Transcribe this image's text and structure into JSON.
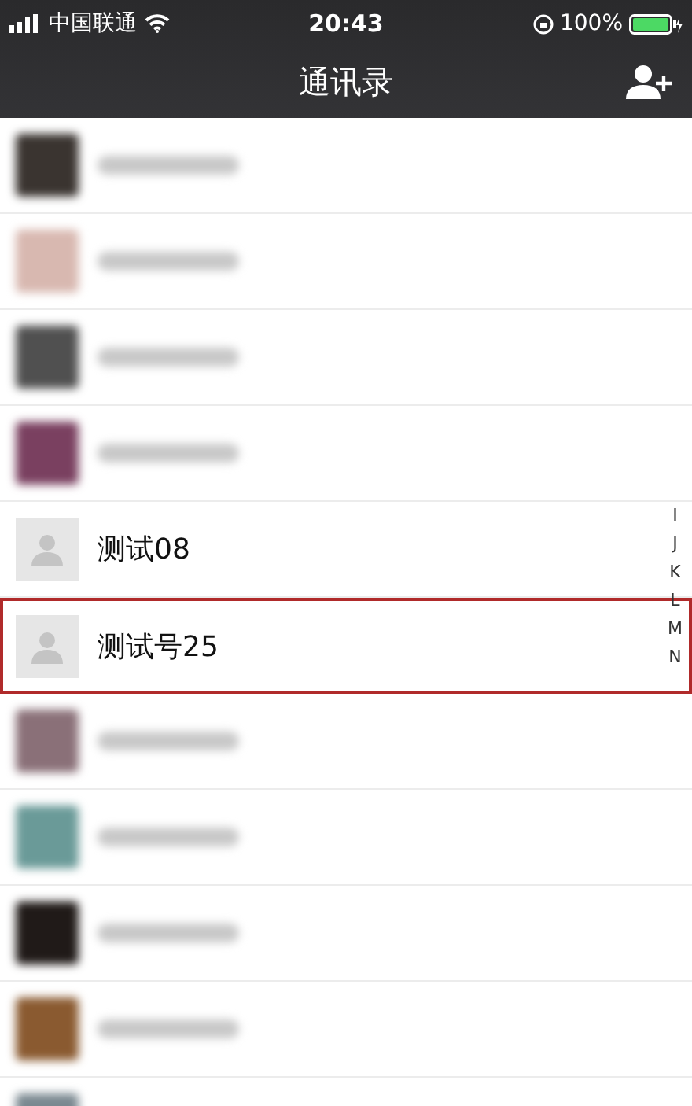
{
  "status_bar": {
    "carrier": "中国联通",
    "time": "20:43",
    "battery": "100%"
  },
  "nav_bar": {
    "title": "通讯录"
  },
  "contacts": [
    {
      "kind": "blurred",
      "color": "#3a3430",
      "highlighted": false
    },
    {
      "kind": "blurred",
      "color": "#d8b8b0",
      "highlighted": false
    },
    {
      "kind": "blurred",
      "color": "#505050",
      "highlighted": false
    },
    {
      "kind": "blurred",
      "color": "#7a4060",
      "highlighted": false
    },
    {
      "kind": "contact",
      "name": "测试08",
      "highlighted": false
    },
    {
      "kind": "contact",
      "name": "测试号25",
      "highlighted": true
    },
    {
      "kind": "blurred",
      "color": "#8a7078",
      "highlighted": false
    },
    {
      "kind": "blurred",
      "color": "#6a9a98",
      "highlighted": false
    },
    {
      "kind": "blurred",
      "color": "#201a18",
      "highlighted": false
    },
    {
      "kind": "blurred",
      "color": "#8a5a30",
      "highlighted": false
    },
    {
      "kind": "blurred_partial",
      "color": "#7a8890",
      "highlighted": false
    }
  ],
  "index_bar": [
    "I",
    "J",
    "K",
    "L",
    "M",
    "N"
  ]
}
